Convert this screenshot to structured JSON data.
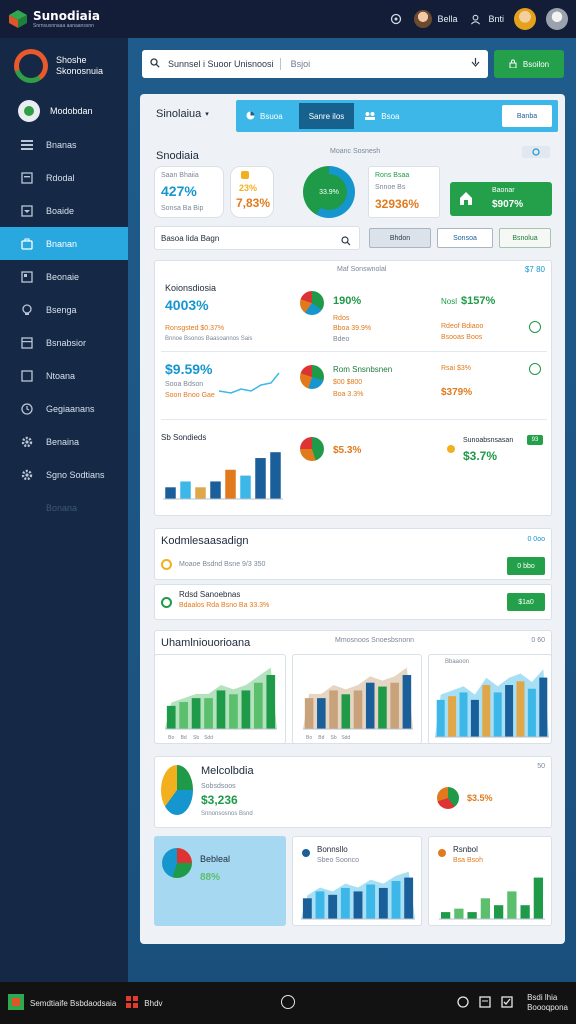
{
  "topbar": {
    "brand_title": "Sunodiaia",
    "brand_sub": "Snrnsusnnaaa aanaanssnn",
    "user1_name": "Bella",
    "user2_name": "Bnti"
  },
  "sidebar": {
    "head_title": "Shoshe",
    "head_sub": "Skonosnuia",
    "user_name": "Modobdan",
    "items": [
      {
        "label": "Bnanas"
      },
      {
        "label": "Rdodal"
      },
      {
        "label": "Boaide"
      },
      {
        "label": "Bnanan"
      },
      {
        "label": "Beonaie"
      },
      {
        "label": "Bsenga"
      },
      {
        "label": "Bsnabsior"
      },
      {
        "label": "Ntoana"
      },
      {
        "label": "Gegiaanans"
      },
      {
        "label": "Benaina"
      },
      {
        "label": "Sgno Sodtians"
      },
      {
        "label": "Bonana"
      }
    ]
  },
  "search": {
    "value": "Sunnsel i Suoor Unisnoosi",
    "placeholder": "Bsjoi",
    "button_label": "Bsoilon"
  },
  "panel": {
    "title": "Sinolaiua",
    "tabs": [
      {
        "label": "Bsuoa"
      },
      {
        "label": "Sanre ilos"
      },
      {
        "label": "Bsoa"
      }
    ],
    "tab_button": "Banba"
  },
  "overview": {
    "title": "Snodiaia",
    "subtitle": "Moanc Sosnesh",
    "kpi1_label": "Saan Bhaiia",
    "kpi1_value": "427%",
    "kpi1_sub": "Sonsa Ba Bip",
    "kpi2_top": "23%",
    "kpi2_value": "7,83%",
    "pie_label": "33.9%",
    "kpi3_label": "Rons Bsaa",
    "kpi3_sub": "Snnoe Bs",
    "kpi3_value": "32936%",
    "green_label": "Baonar",
    "green_value": "$907%",
    "filter_label": "Basoa lida Bagn",
    "btn1": "Bhdon",
    "btn2": "Sonsoa",
    "btn3": "Bsnolua"
  },
  "analytics": {
    "header_right": "Maf Sonswnolal",
    "corner": "$7 80",
    "r1_title": "Koionsdiosia",
    "r1_value": "4003%",
    "r1_sub": "Ronsgsted $0.37%",
    "r1_note": "Bnnoe Bsonos Baasoannos Sais",
    "r1_mid_value": "190%",
    "r1_mid_a": "Rdos",
    "r1_mid_b": "Bboa 39.9%",
    "r1_mid_c": "Bdeo",
    "r1_right_label": "Nosl",
    "r1_right_value": "$157%",
    "r1_right_b": "Rdeof Bdiaoo",
    "r1_right_c": "Bsooas Boos",
    "r2_value": "$9.59%",
    "r2_a": "Sooa Bdson",
    "r2_b": "Soon Bnoo Gae",
    "r2_mid_title": "Rom Snsnbsnen",
    "r2_mid_a": "$00 $800",
    "r2_mid_b": "Boa 3.3%",
    "r2_right_a": "Rsai $3%",
    "r2_right_value": "$379%",
    "r3_title": "Sb Sondieds",
    "r3_mid_value": "$5.3%",
    "r3_right_title": "Sunoabsnsasan",
    "r3_right_value": "$3.7%",
    "r3_chip": "93"
  },
  "list": {
    "title": "Kodmlesaasadign",
    "corner": "0 0oo",
    "row1": "Moaoe Bsdnd Bsne 9/3 350",
    "row1_btn": "0 bbo",
    "row2_title": "Rdsd Sanoebnas",
    "row2_sub": "Bdaalos Rda Bsno Ba 33.3%",
    "row2_btn": "$1a0"
  },
  "charts": {
    "title": "Uhamlniouorioana",
    "subtitle": "Mmosnoos Snoesbsnonn",
    "corner": "0 60",
    "mini_label": "Bbaaoon",
    "labels": [
      "Bo",
      "Bd",
      "Sb",
      "Sdd"
    ]
  },
  "summary": {
    "title": "Melcolbdia",
    "sub": "Sobsdsoos",
    "value": "$3,236",
    "note": "Snnonsosnos Bsnd",
    "right_value": "$3.5%",
    "corner": "50"
  },
  "bottom": {
    "card1_title": "Bebleal",
    "card1_value": "88%",
    "card2_title": "Bonnsllo",
    "card2_sub": "Sbeo Soonco",
    "card3_title": "Rsnbol",
    "card3_sub": "Bsa Bsoh"
  },
  "taskbar": {
    "app_label": "Semdtiaife Bsbdaodsaia",
    "app2_label": "Bhdv",
    "clock_line1": "Bsdi lhia",
    "clock_line2": "Boooqpona"
  },
  "chart_data": [
    {
      "type": "bar",
      "categories": [
        "1",
        "2",
        "3",
        "4",
        "5",
        "6",
        "7",
        "8"
      ],
      "values": [
        2,
        3,
        2,
        3,
        5,
        4,
        7,
        8
      ]
    },
    {
      "type": "bar",
      "categories": [
        "Bo",
        "Bd",
        "Sb",
        "Sdd",
        "5",
        "6",
        "7",
        "8",
        "9"
      ],
      "values": [
        3,
        3.5,
        4,
        4,
        5,
        4.5,
        5,
        6,
        7
      ]
    },
    {
      "type": "bar",
      "categories": [
        "Bo",
        "Bd",
        "Sb",
        "Sdd",
        "5",
        "6",
        "7",
        "8",
        "9"
      ],
      "values": [
        4,
        4,
        5,
        4.5,
        5,
        6,
        5.5,
        6,
        7
      ]
    },
    {
      "type": "bar",
      "categories": [
        "1",
        "2",
        "3",
        "4",
        "5",
        "6",
        "7",
        "8",
        "9",
        "10"
      ],
      "values": [
        5,
        5.5,
        6,
        5,
        7,
        6,
        7,
        7.5,
        6.5,
        8
      ]
    },
    {
      "type": "bar",
      "categories": [
        "1",
        "2",
        "3",
        "4",
        "5",
        "6",
        "7",
        "8",
        "9"
      ],
      "values": [
        3,
        4,
        3.5,
        4.5,
        4,
        5,
        4.5,
        5.5,
        6
      ]
    },
    {
      "type": "bar",
      "categories": [
        "1",
        "2",
        "3",
        "4",
        "5",
        "6",
        "7",
        "8"
      ],
      "values": [
        1,
        1.5,
        1,
        3,
        2,
        4,
        2,
        6
      ]
    }
  ]
}
